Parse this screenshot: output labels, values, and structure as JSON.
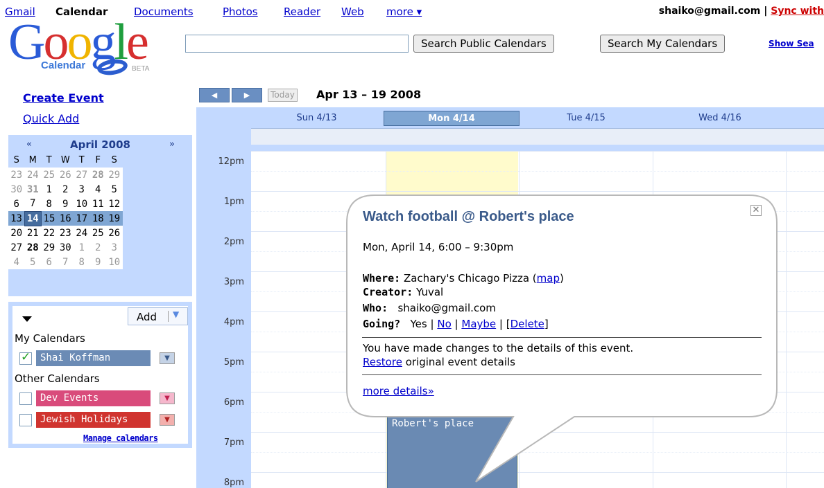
{
  "topnav": {
    "links": [
      "Gmail",
      "Calendar",
      "Documents",
      "Photos",
      "Reader",
      "Web",
      "more ▾"
    ],
    "account_email": "shaiko@gmail.com",
    "separator": " | ",
    "sync_label": "Sync with"
  },
  "logo": {
    "word": "Google",
    "sub": "Calendar",
    "beta": "BETA"
  },
  "search": {
    "query": "",
    "public_btn": "Search Public Calendars",
    "my_btn": "Search My Calendars",
    "show_options": "Show Sea"
  },
  "sidebar": {
    "create_event": "Create Event",
    "quick_add": "Quick Add"
  },
  "minical": {
    "prev": "«",
    "next": "»",
    "title": "April 2008",
    "dow": [
      "S",
      "M",
      "T",
      "W",
      "T",
      "F",
      "S"
    ],
    "weeks": [
      [
        "23",
        "24",
        "25",
        "26",
        "27",
        "28",
        "29"
      ],
      [
        "30",
        "31",
        "1",
        "2",
        "3",
        "4",
        "5"
      ],
      [
        "6",
        "7",
        "8",
        "9",
        "10",
        "11",
        "12"
      ],
      [
        "13",
        "14",
        "15",
        "16",
        "17",
        "18",
        "19"
      ],
      [
        "20",
        "21",
        "22",
        "23",
        "24",
        "25",
        "26"
      ],
      [
        "27",
        "28",
        "29",
        "30",
        "1",
        "2",
        "3"
      ],
      [
        "4",
        "5",
        "6",
        "7",
        "8",
        "9",
        "10"
      ]
    ]
  },
  "calendars": {
    "add_label": "Add",
    "my_heading": "My Calendars",
    "other_heading": "Other Calendars",
    "my": [
      {
        "name": "Shai Koffman",
        "checked": true,
        "color": "#6b8bb5"
      }
    ],
    "other": [
      {
        "name": "Dev Events",
        "checked": false,
        "color": "#d94b7b"
      },
      {
        "name": "Jewish Holidays",
        "checked": false,
        "color": "#d0342f"
      }
    ],
    "manage": "Manage calendars"
  },
  "toolbar": {
    "prev": "◀",
    "next": "▶",
    "today": "Today",
    "range": "Apr 13 – 19 2008"
  },
  "days": [
    "Sun 4/13",
    "Mon 4/14",
    "Tue 4/15",
    "Wed 4/16"
  ],
  "hours": [
    "12pm",
    "1pm",
    "2pm",
    "3pm",
    "4pm",
    "5pm",
    "6pm",
    "7pm",
    "8pm"
  ],
  "event": {
    "visible_title": "Robert's place",
    "color": "#6a8ab3"
  },
  "bubble": {
    "title": "Watch football @ Robert's place",
    "close": "✕",
    "when": "Mon, April 14, 6:00 – 9:30pm",
    "where_label": "Where:",
    "where": "Zachary's Chicago Pizza",
    "map_open": "(",
    "map_link": "map",
    "map_close": ")",
    "creator_label": "Creator:",
    "creator": "Yuval",
    "who_label": "Who:",
    "who": "shaiko@gmail.com",
    "going_label": "Going?",
    "going_yes": "Yes",
    "going_no": "No",
    "going_maybe": "Maybe",
    "going_delete": "Delete",
    "sep": "|",
    "bracket_open": "[",
    "bracket_close": "]",
    "changes_msg": "You have made changes to the details of this event.",
    "restore_link": "Restore",
    "restore_rest": "original event details",
    "more_details": "more details»"
  },
  "colors": {
    "accent_blue": "#c3d9ff",
    "today_yellow": "#fffbcc",
    "sync_red": "#cc0000"
  }
}
